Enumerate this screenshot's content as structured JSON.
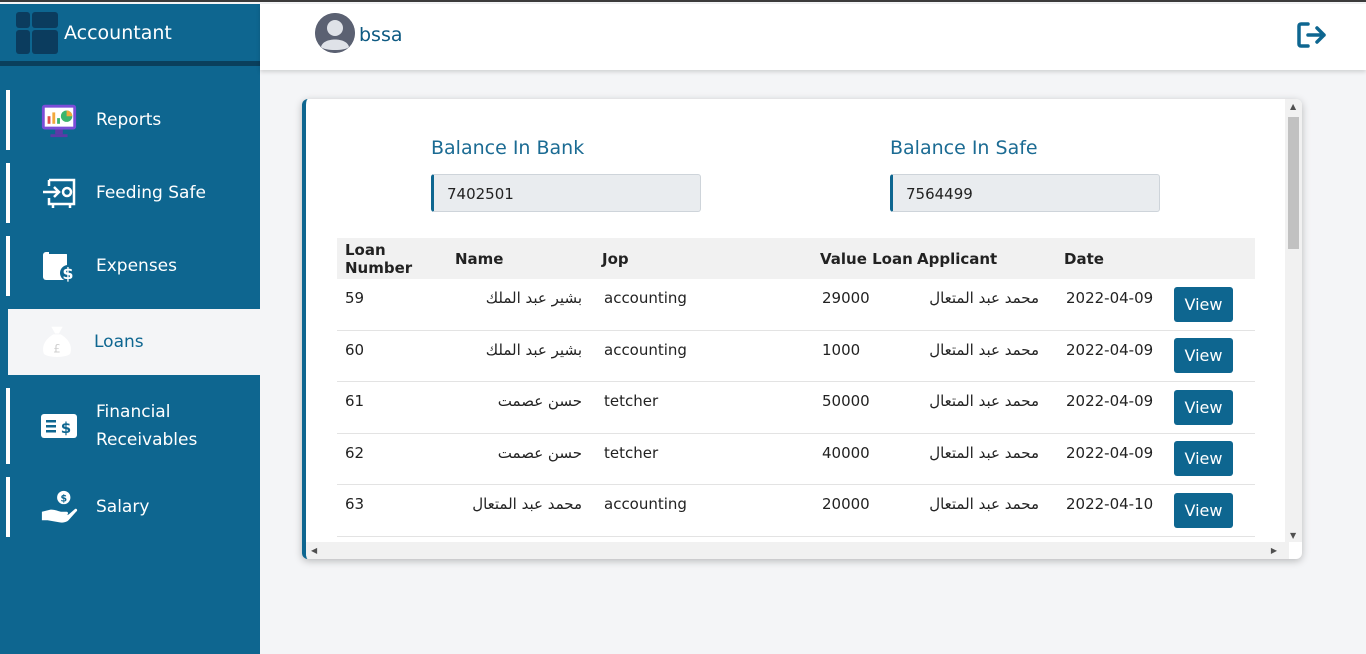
{
  "app": {
    "title": "Accountant"
  },
  "user": {
    "name": "bssa"
  },
  "sidebar": {
    "items": [
      {
        "label": "Reports",
        "icon": "reports-icon"
      },
      {
        "label": "Feeding Safe",
        "icon": "safe-icon"
      },
      {
        "label": "Expenses",
        "icon": "expenses-icon"
      },
      {
        "label": "Loans",
        "icon": "money-bag-icon",
        "active": true
      },
      {
        "label": "Financial Receivables",
        "icon": "receivables-icon"
      },
      {
        "label": "Salary",
        "icon": "salary-hand-icon"
      }
    ]
  },
  "balances": {
    "bank_label": "Balance In Bank",
    "bank_value": "7402501",
    "safe_label": "Balance In Safe",
    "safe_value": "7564499"
  },
  "table": {
    "headers": [
      "Loan Number",
      "Name",
      "Jop",
      "Value Loan",
      "Applicant",
      "Date"
    ],
    "rows": [
      {
        "number": "59",
        "name": "بشير عبد الملك",
        "job": "accounting",
        "value": "29000",
        "applicant": "محمد عبد المتعال",
        "date": "2022-04-09",
        "action": "View"
      },
      {
        "number": "60",
        "name": "بشير عبد الملك",
        "job": "accounting",
        "value": "1000",
        "applicant": "محمد عبد المتعال",
        "date": "2022-04-09",
        "action": "View"
      },
      {
        "number": "61",
        "name": "حسن عصمت",
        "job": "tetcher",
        "value": "50000",
        "applicant": "محمد عبد المتعال",
        "date": "2022-04-09",
        "action": "View"
      },
      {
        "number": "62",
        "name": "حسن عصمت",
        "job": "tetcher",
        "value": "40000",
        "applicant": "محمد عبد المتعال",
        "date": "2022-04-09",
        "action": "View"
      },
      {
        "number": "63",
        "name": "محمد عبد المتعال",
        "job": "accounting",
        "value": "20000",
        "applicant": "محمد عبد المتعال",
        "date": "2022-04-10",
        "action": "View"
      }
    ]
  },
  "colors": {
    "primary": "#0e6690",
    "dark": "#0a3f5c",
    "background": "#f4f5f7"
  }
}
